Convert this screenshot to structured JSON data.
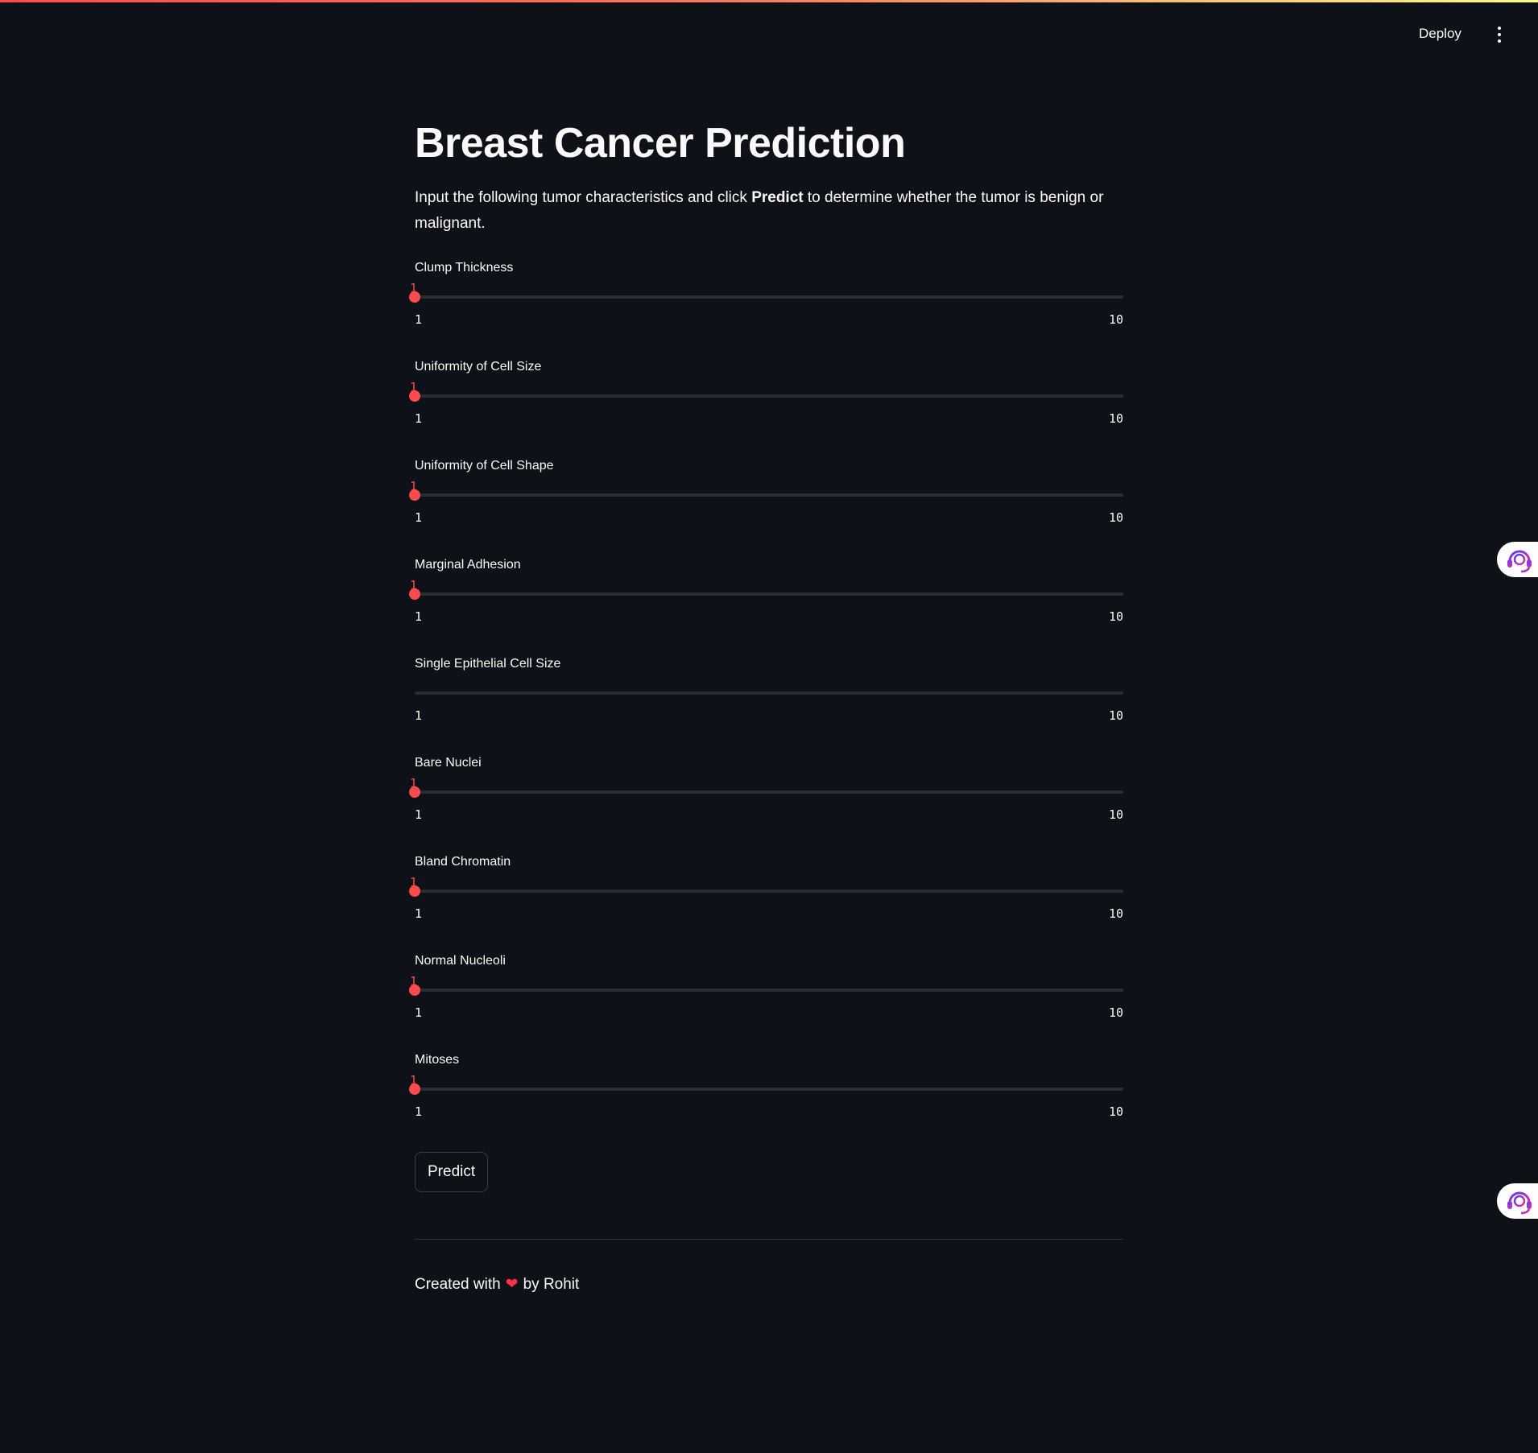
{
  "header": {
    "deploy_label": "Deploy",
    "menu_icon": "vertical-ellipsis-icon"
  },
  "main": {
    "title": "Breast Cancer Prediction",
    "intro_before": "Input the following tumor characteristics and click ",
    "intro_bold": "Predict",
    "intro_after": " to determine whether the tumor is benign or malignant.",
    "sliders": [
      {
        "label": "Clump Thickness",
        "value": "1",
        "min": "1",
        "max": "10",
        "value_visible": true
      },
      {
        "label": "Uniformity of Cell Size",
        "value": "1",
        "min": "1",
        "max": "10",
        "value_visible": true
      },
      {
        "label": "Uniformity of Cell Shape",
        "value": "1",
        "min": "1",
        "max": "10",
        "value_visible": true
      },
      {
        "label": "Marginal Adhesion",
        "value": "1",
        "min": "1",
        "max": "10",
        "value_visible": true
      },
      {
        "label": "Single Epithelial Cell Size",
        "value": "",
        "min": "1",
        "max": "10",
        "value_visible": false
      },
      {
        "label": "Bare Nuclei",
        "value": "1",
        "min": "1",
        "max": "10",
        "value_visible": true
      },
      {
        "label": "Bland Chromatin",
        "value": "1",
        "min": "1",
        "max": "10",
        "value_visible": true
      },
      {
        "label": "Normal Nucleoli",
        "value": "1",
        "min": "1",
        "max": "10",
        "value_visible": true
      },
      {
        "label": "Mitoses",
        "value": "1",
        "min": "1",
        "max": "10",
        "value_visible": true
      }
    ],
    "predict_label": "Predict"
  },
  "footer": {
    "prefix": "Created with",
    "heart": "❤",
    "suffix": "by Rohit"
  },
  "floating": {
    "assistant_icon": "headset-support-icon"
  },
  "colors": {
    "background": "#0e1117",
    "accent": "#ff4b4b",
    "track": "#2b2d35",
    "text": "#fafafa"
  }
}
